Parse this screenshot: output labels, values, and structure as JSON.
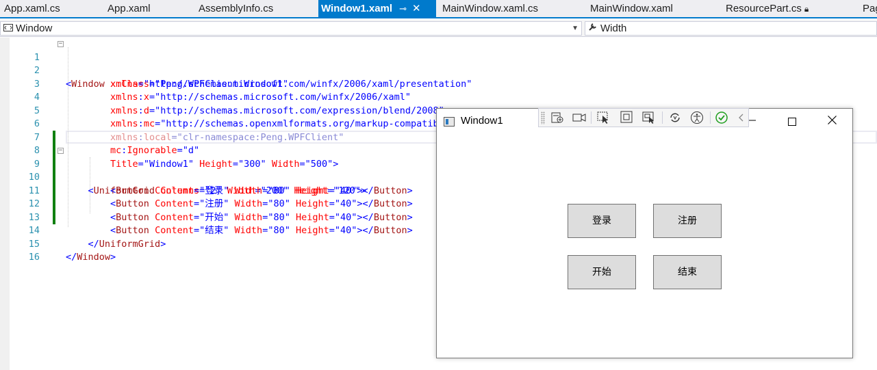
{
  "tabs": [
    {
      "label": "App.xaml.cs"
    },
    {
      "label": "App.xaml"
    },
    {
      "label": "AssemblyInfo.cs"
    },
    {
      "label": "Window1.xaml",
      "active": true
    },
    {
      "label": "MainWindow.xaml.cs"
    },
    {
      "label": "MainWindow.xaml"
    },
    {
      "label": "ResourcePart.cs",
      "locked": true
    },
    {
      "label": "Pag"
    }
  ],
  "navbar": {
    "left_value": "Window",
    "right_value": "Width"
  },
  "editor": {
    "line_numbers": [
      "1",
      "2",
      "3",
      "4",
      "5",
      "6",
      "7",
      "8",
      "9",
      "10",
      "11",
      "12",
      "13",
      "14",
      "15",
      "16"
    ],
    "lines": {
      "l1": {
        "tag": "Window",
        "attr": "x:Class",
        "val": "\"Peng.WPFClient.Window1\""
      },
      "l2": {
        "attr": "xmlns",
        "val": "\"http://schemas.microsoft.com/winfx/2006/xaml/presentation\""
      },
      "l3": {
        "attr_ns": "xmlns",
        "attr": "x",
        "val": "\"http://schemas.microsoft.com/winfx/2006/xaml\""
      },
      "l4": {
        "attr_ns": "xmlns",
        "attr": "d",
        "val": "\"http://schemas.microsoft.com/expression/blend/2008\""
      },
      "l5": {
        "attr_ns": "xmlns",
        "attr": "mc",
        "val": "\"http://schemas.openxmlformats.org/markup-compatibility/2006\""
      },
      "l6": {
        "attr_ns": "xmlns",
        "attr": "local",
        "val": "\"clr-namespace:Peng.WPFClient\""
      },
      "l7": {
        "attr_ns": "mc",
        "attr": "Ignorable",
        "val": "\"d\""
      },
      "l8": {
        "a1": "Title",
        "v1": "\"Window1\"",
        "a2": "Height",
        "v2": "\"300\"",
        "a3": "Width",
        "v3": "\"500\""
      },
      "l9": {
        "tag": "UniformGrid",
        "a1": "Columns",
        "v1": "\"2\"",
        "a2": "Width",
        "v2": "\"200\"",
        "a3": "Height",
        "v3": "\"120\""
      },
      "l10": {
        "tag": "Button",
        "a1": "Content",
        "v1": "\"登录\"",
        "a2": "Width",
        "v2": "\"80\"",
        "a3": "Height",
        "v3": "\"40\"",
        "end": "Button"
      },
      "l11": {
        "tag": "Button",
        "a1": "Content",
        "v1": "\"注册\"",
        "a2": "Width",
        "v2": "\"80\"",
        "a3": "Height",
        "v3": "\"40\"",
        "end": "Button"
      },
      "l12": {
        "tag": "Button",
        "a1": "Content",
        "v1": "\"开始\"",
        "a2": "Width",
        "v2": "\"80\"",
        "a3": "Height",
        "v3": "\"40\"",
        "end": "Button"
      },
      "l13": {
        "tag": "Button",
        "a1": "Content",
        "v1": "\"结束\"",
        "a2": "Width",
        "v2": "\"80\"",
        "a3": "Height",
        "v3": "\"40\"",
        "end": "Button"
      },
      "l14": {
        "end": "UniformGrid"
      },
      "l15": {
        "end": "Window"
      }
    }
  },
  "preview": {
    "title": "Window1",
    "buttons": [
      "登录",
      "注册",
      "开始",
      "结束"
    ]
  },
  "colors": {
    "accent": "#007acc",
    "change_bar": "#108010",
    "line_number": "#2b91af"
  }
}
